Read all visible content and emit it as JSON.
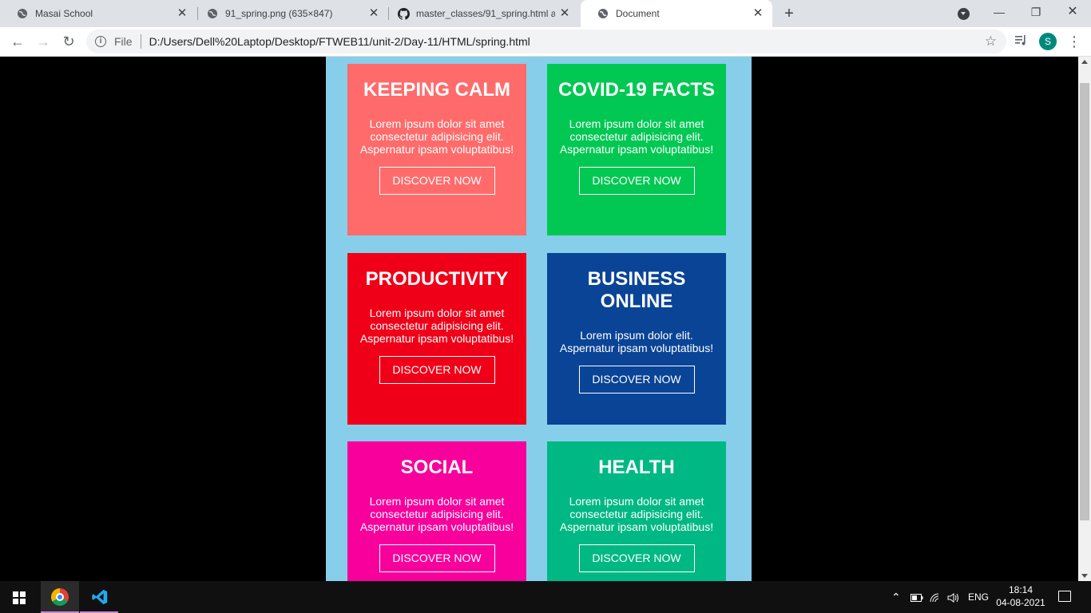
{
  "browser": {
    "tabs": [
      {
        "title": "Masai School",
        "icon": "globe-icon",
        "active": false
      },
      {
        "title": "91_spring.png (635×847)",
        "icon": "globe-icon",
        "active": false
      },
      {
        "title": "master_classes/91_spring.html at",
        "icon": "github-icon",
        "active": false
      },
      {
        "title": "Document",
        "icon": "globe-icon",
        "active": true
      }
    ],
    "new_tab": "+",
    "address_scheme": "File",
    "address_url": "D:/Users/Dell%20Laptop/Desktop/FTWEB11/unit-2/Day-11/HTML/spring.html",
    "profile_initial": "S",
    "profile_color": "#00897b"
  },
  "page": {
    "background": "#000000",
    "container_color": "#87ceeb",
    "cards": [
      {
        "title": "KEEPING CALM",
        "text": "Lorem ipsum dolor sit amet consectetur adipisicing elit. Aspernatur ipsam voluptatibus!",
        "button": "DISCOVER NOW",
        "color": "#ff6b6b"
      },
      {
        "title": "COVID-19 FACTS",
        "text": "Lorem ipsum dolor sit amet consectetur adipisicing elit. Aspernatur ipsam voluptatibus!",
        "button": "DISCOVER NOW",
        "color": "#00c853"
      },
      {
        "title": "PRODUCTIVITY",
        "text": "Lorem ipsum dolor sit amet consectetur adipisicing elit. Aspernatur ipsam voluptatibus!",
        "button": "DISCOVER NOW",
        "color": "#f00018"
      },
      {
        "title": "BUSINESS ONLINE",
        "text": "Lorem ipsum dolor elit. Aspernatur ipsam voluptatibus!",
        "button": "DISCOVER NOW",
        "color": "#0a4496"
      },
      {
        "title": "SOCIAL",
        "text": "Lorem ipsum dolor sit amet consectetur adipisicing elit. Aspernatur ipsam voluptatibus!",
        "button": "DISCOVER NOW",
        "color": "#f7009c"
      },
      {
        "title": "HEALTH",
        "text": "Lorem ipsum dolor sit amet consectetur adipisicing elit. Aspernatur ipsam voluptatibus!",
        "button": "DISCOVER NOW",
        "color": "#00b884"
      }
    ]
  },
  "taskbar": {
    "apps": [
      {
        "name": "Google Chrome",
        "icon": "chrome-icon",
        "active": true
      },
      {
        "name": "Visual Studio Code",
        "icon": "vscode-icon",
        "active": false
      }
    ],
    "language": "ENG",
    "time": "18:14",
    "date": "04-08-2021"
  }
}
